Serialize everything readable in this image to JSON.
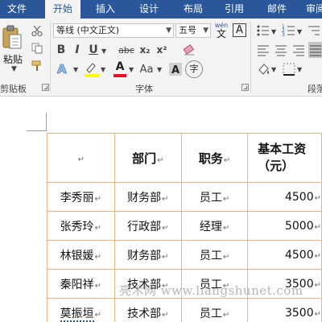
{
  "tabs": [
    {
      "label": "文件",
      "active": false
    },
    {
      "label": "开始",
      "active": true
    },
    {
      "label": "插入",
      "active": false
    },
    {
      "label": "设计",
      "active": false
    },
    {
      "label": "布局",
      "active": false
    },
    {
      "label": "引用",
      "active": false
    },
    {
      "label": "邮件",
      "active": false
    },
    {
      "label": "审阅",
      "active": false
    }
  ],
  "ribbon": {
    "clipboard": {
      "paste_label": "粘贴",
      "group_label": "剪贴板"
    },
    "font": {
      "font_name": "等线 (中文正文)",
      "font_size": "五号",
      "wen_glyph": "wén",
      "wen_char": "文",
      "box_a": "A",
      "group_label": "字体",
      "bold": "B",
      "italic": "I",
      "underline": "U",
      "strike": "abc",
      "subscript": "x₂",
      "superscript": "x²",
      "font_color_a": "A",
      "case": "Aa"
    },
    "paragraph": {
      "group_label": "段落"
    }
  },
  "table": {
    "header": [
      "",
      "部门",
      "职务",
      "基本工资\n（元）"
    ],
    "rows": [
      [
        "李秀丽",
        "财务部",
        "员工",
        "4500"
      ],
      [
        "张秀玲",
        "行政部",
        "经理",
        "5000"
      ],
      [
        "林银媛",
        "财务部",
        "员工",
        "4500"
      ],
      [
        "秦阳祥",
        "技术部",
        "员工",
        "3500"
      ],
      [
        "莫振垣",
        "技术部",
        "员工",
        "3500"
      ]
    ],
    "mark": "↵"
  },
  "watermark": "亮术网 www.liangshunet.com",
  "colors": {
    "tab_bar": "#2b579a",
    "ribbon_bg": "#f3f3f3",
    "table_border": "#f4b183",
    "highlight_yellow": "#ffff00",
    "font_color_red": "#e81123"
  }
}
